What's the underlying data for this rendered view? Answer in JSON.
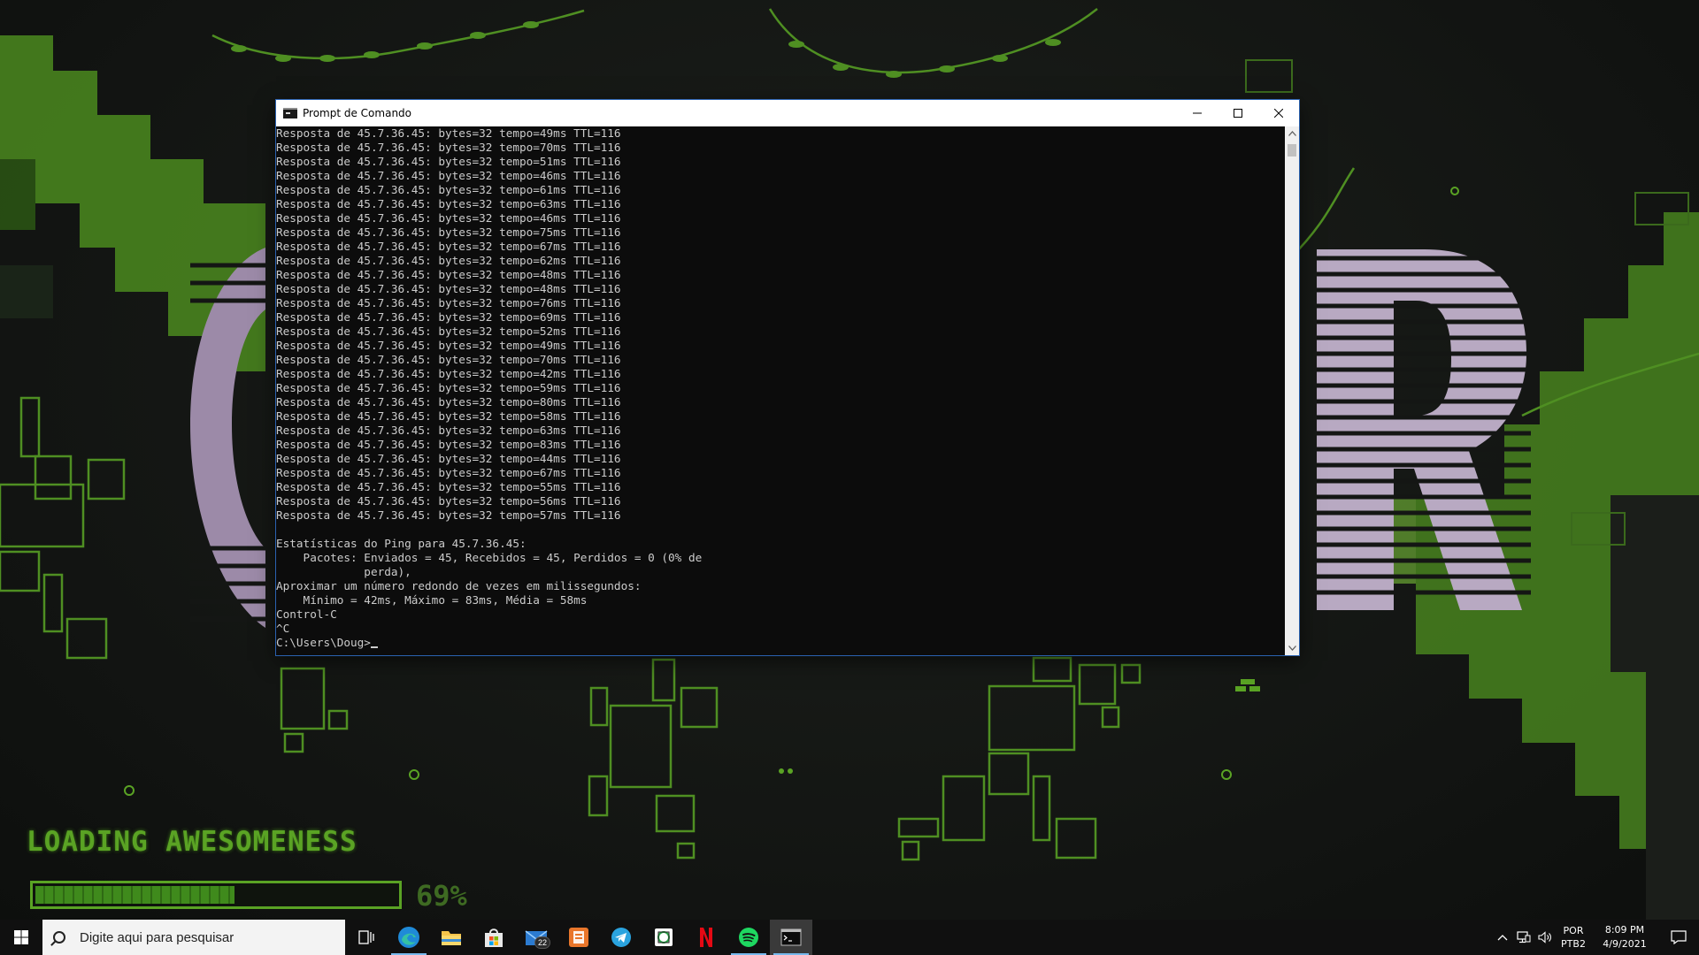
{
  "wallpaper": {
    "loading_text": "LOADING AWESOMENESS",
    "progress_percent": 69,
    "progress_label": "69%"
  },
  "window": {
    "title": "Prompt de Comando",
    "minimize": "—",
    "maximize": "☐",
    "close": "✕"
  },
  "console": {
    "lines": [
      "Resposta de 45.7.36.45: bytes=32 tempo=49ms TTL=116",
      "Resposta de 45.7.36.45: bytes=32 tempo=70ms TTL=116",
      "Resposta de 45.7.36.45: bytes=32 tempo=51ms TTL=116",
      "Resposta de 45.7.36.45: bytes=32 tempo=46ms TTL=116",
      "Resposta de 45.7.36.45: bytes=32 tempo=61ms TTL=116",
      "Resposta de 45.7.36.45: bytes=32 tempo=63ms TTL=116",
      "Resposta de 45.7.36.45: bytes=32 tempo=46ms TTL=116",
      "Resposta de 45.7.36.45: bytes=32 tempo=75ms TTL=116",
      "Resposta de 45.7.36.45: bytes=32 tempo=67ms TTL=116",
      "Resposta de 45.7.36.45: bytes=32 tempo=62ms TTL=116",
      "Resposta de 45.7.36.45: bytes=32 tempo=48ms TTL=116",
      "Resposta de 45.7.36.45: bytes=32 tempo=48ms TTL=116",
      "Resposta de 45.7.36.45: bytes=32 tempo=76ms TTL=116",
      "Resposta de 45.7.36.45: bytes=32 tempo=69ms TTL=116",
      "Resposta de 45.7.36.45: bytes=32 tempo=52ms TTL=116",
      "Resposta de 45.7.36.45: bytes=32 tempo=49ms TTL=116",
      "Resposta de 45.7.36.45: bytes=32 tempo=70ms TTL=116",
      "Resposta de 45.7.36.45: bytes=32 tempo=42ms TTL=116",
      "Resposta de 45.7.36.45: bytes=32 tempo=59ms TTL=116",
      "Resposta de 45.7.36.45: bytes=32 tempo=80ms TTL=116",
      "Resposta de 45.7.36.45: bytes=32 tempo=58ms TTL=116",
      "Resposta de 45.7.36.45: bytes=32 tempo=63ms TTL=116",
      "Resposta de 45.7.36.45: bytes=32 tempo=83ms TTL=116",
      "Resposta de 45.7.36.45: bytes=32 tempo=44ms TTL=116",
      "Resposta de 45.7.36.45: bytes=32 tempo=67ms TTL=116",
      "Resposta de 45.7.36.45: bytes=32 tempo=55ms TTL=116",
      "Resposta de 45.7.36.45: bytes=32 tempo=56ms TTL=116",
      "Resposta de 45.7.36.45: bytes=32 tempo=57ms TTL=116",
      "",
      "Estatísticas do Ping para 45.7.36.45:",
      "    Pacotes: Enviados = 45, Recebidos = 45, Perdidos = 0 (0% de",
      "             perda),",
      "Aproximar um número redondo de vezes em milissegundos:",
      "    Mínimo = 42ms, Máximo = 83ms, Média = 58ms",
      "Control-C",
      "^C"
    ],
    "prompt": "C:\\Users\\Doug>"
  },
  "taskbar": {
    "search_placeholder": "Digite aqui para pesquisar",
    "mail_badge": "22",
    "apps": [
      "task-view",
      "edge",
      "file-explorer",
      "microsoft-store",
      "mail",
      "office",
      "telegram",
      "whatsapp",
      "netflix",
      "spotify",
      "command-prompt"
    ],
    "language_line1": "POR",
    "language_line2": "PTB2",
    "time": "8:09 PM",
    "date": "4/9/2021"
  },
  "colors": {
    "accent_green": "#5aa324",
    "console_bg": "#0c0c0c",
    "console_fg": "#cccccc",
    "taskbar_bg": "#101010"
  }
}
